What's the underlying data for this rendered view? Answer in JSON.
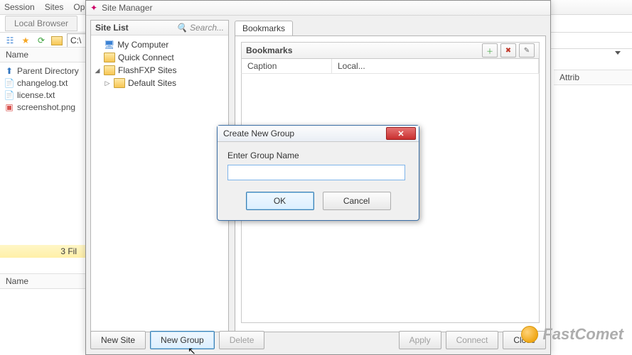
{
  "menu": {
    "session": "Session",
    "sites": "Sites",
    "options": "Op"
  },
  "local_browser_tab": "Local Browser",
  "path_value": "C:\\",
  "left_header": "Name",
  "files": {
    "parent": "Parent Directory",
    "f1": "changelog.txt",
    "f2": "license.txt",
    "f3": "screenshot.png"
  },
  "status_text": "3 Fil",
  "lower_name": "Name",
  "right_header": "Attrib",
  "site_manager": {
    "title": "Site Manager",
    "site_list_label": "Site List",
    "search_placeholder": "Search...",
    "tree": {
      "my_computer": "My Computer",
      "quick_connect": "Quick Connect",
      "flashfxp": "FlashFXP Sites",
      "default_sites": "Default Sites"
    },
    "tab_bookmarks": "Bookmarks",
    "bookmarks_header": "Bookmarks",
    "cols": {
      "caption": "Caption",
      "local": "Local..."
    },
    "buttons": {
      "new_site": "New Site",
      "new_group": "New Group",
      "delete": "Delete",
      "apply": "Apply",
      "connect": "Connect",
      "close": "Close"
    }
  },
  "dialog": {
    "title": "Create New Group",
    "label": "Enter Group Name",
    "value": "",
    "ok": "OK",
    "cancel": "Cancel"
  },
  "brand": "FastComet"
}
